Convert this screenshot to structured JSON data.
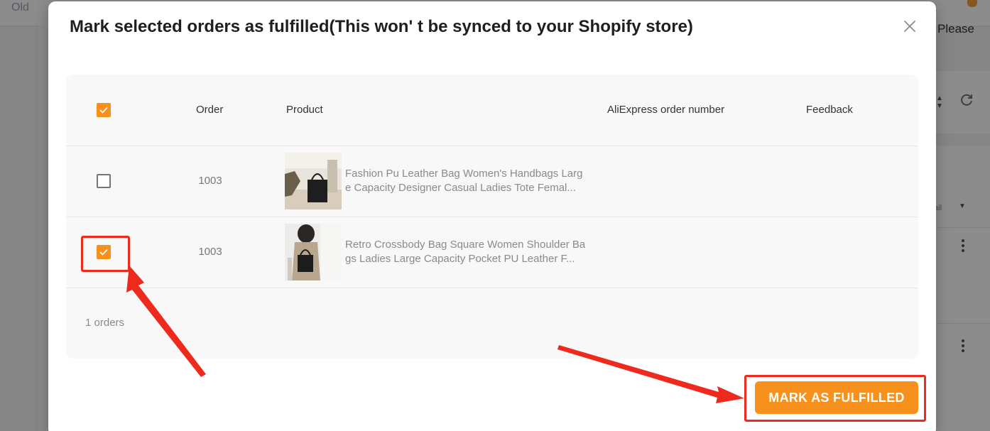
{
  "background": {
    "top_left_text": "Old",
    "top_right_text": "Please",
    "detail_text": "tail"
  },
  "modal": {
    "title": "Mark selected orders as fulfilled(This won' t be synced to your Shopify store)",
    "table": {
      "columns": [
        "Order",
        "Product",
        "AliExpress order number",
        "Feedback"
      ],
      "select_all_checked": true,
      "rows": [
        {
          "checked": false,
          "order": "1003",
          "product_title": "Fashion Pu Leather Bag Women's Handbags Large Capacity Designer Casual Ladies Tote Femal...",
          "aliexpress_order_number": "",
          "feedback": ""
        },
        {
          "checked": true,
          "order": "1003",
          "product_title": "Retro Crossbody Bag Square Women Shoulder Bags Ladies Large Capacity Pocket PU Leather F...",
          "aliexpress_order_number": "",
          "feedback": ""
        }
      ],
      "summary": "1 orders"
    },
    "primary_button_label": "MARK AS FULFILLED"
  },
  "colors": {
    "accent": "#f6911e",
    "annotation_red": "#ee2a1f"
  },
  "icons": {
    "close": "close-icon",
    "checkbox": "check-icon",
    "refresh": "refresh-icon",
    "more": "more-vertical-icon"
  }
}
